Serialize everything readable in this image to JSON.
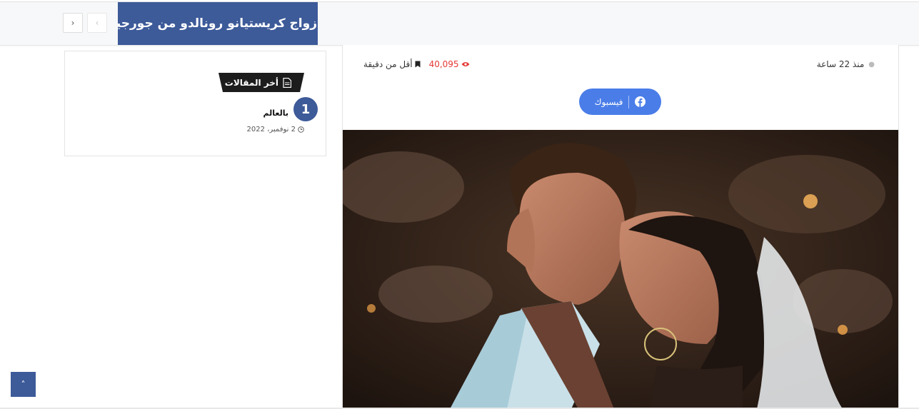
{
  "ticker": {
    "headline": "زواج كريستيانو رونالدو من جورجينا سراً",
    "next_icon": "chevron-right-icon",
    "prev_icon": "chevron-left-icon"
  },
  "sidebar": {
    "widget_title": "أخر المقالات",
    "widget_icon": "document-icon",
    "posts": [
      {
        "number": "1",
        "title": "بالعالم",
        "date": "2 نوفمبر، 2022"
      }
    ]
  },
  "article": {
    "time_ago": "منذ 22 ساعة",
    "views": "40,095",
    "read_time": "أقل من دقيقة",
    "share_facebook_label": "فيسبوك",
    "image_alt": "wedding kiss photo"
  },
  "colors": {
    "brand": "#3d5a99",
    "facebook": "#4a7de8",
    "views": "#e53935"
  }
}
